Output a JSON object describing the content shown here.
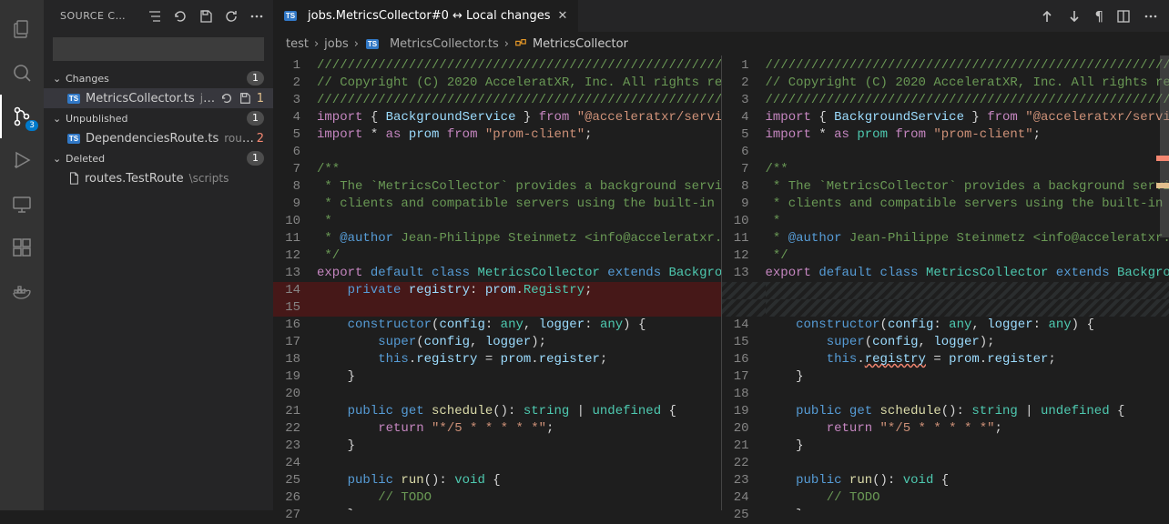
{
  "activity": {
    "scm_badge": "3"
  },
  "sidebar": {
    "title": "SOURCE C…",
    "sections": {
      "changes": {
        "label": "Changes",
        "count": "1"
      },
      "unpublished": {
        "label": "Unpublished",
        "count": "1"
      },
      "deleted": {
        "label": "Deleted",
        "count": "1"
      }
    },
    "files": {
      "changes0": {
        "name": "MetricsCollector.ts",
        "dir": "jobs",
        "status": "1"
      },
      "unpub0": {
        "name": "DependenciesRoute.ts",
        "dir": "routes",
        "status": "2"
      },
      "deleted0": {
        "name": "routes.TestRoute",
        "dir": "\\scripts"
      }
    }
  },
  "tab": {
    "icon": "TS",
    "title": "jobs.MetricsCollector#0 ↔ Local changes"
  },
  "breadcrumb": {
    "a": "test",
    "b": "jobs",
    "c": "MetricsCollector.ts",
    "d": "MetricsCollector"
  },
  "left": {
    "lines": [
      "1",
      "2",
      "3",
      "4",
      "5",
      "6",
      "7",
      "8",
      "9",
      "10",
      "11",
      "12",
      "13",
      "14",
      "15",
      "16",
      "17",
      "18",
      "19",
      "20",
      "21",
      "22",
      "23",
      "24",
      "25",
      "26",
      "27"
    ]
  },
  "right": {
    "lines": [
      "1",
      "2",
      "3",
      "4",
      "5",
      "6",
      "7",
      "8",
      "9",
      "10",
      "11",
      "12",
      "13",
      "",
      "",
      "14",
      "15",
      "16",
      "17",
      "18",
      "19",
      "20",
      "21",
      "22",
      "23",
      "24",
      "25"
    ]
  },
  "code": {
    "l1": "///////////////////////////////////////////////////////////",
    "l2": "// Copyright (C) 2020 AcceleratXR, Inc. All rights res",
    "l3": "///////////////////////////////////////////////////////////",
    "l4a": "import",
    "l4b": " { ",
    "l4c": "BackgroundService",
    "l4d": " } ",
    "l4e": "from",
    "l4f": " \"@acceleratxr/servic",
    "l5a": "import",
    "l5b": " * ",
    "l5c": "as",
    "l5d": " prom ",
    "l5e": "from",
    "l5f": " \"prom-client\"",
    "l5g": ";",
    "l7": "/**",
    "l8": " * The `MetricsCollector` provides a background servic",
    "l9": " * clients and compatible servers using the built-in `",
    "l10": " *",
    "l11a": " * ",
    "l11b": "@author",
    "l11c": " Jean-Philippe Steinmetz <info@acceleratxr.c",
    "l12": " */",
    "l13a": "export",
    "l13b": " default ",
    "l13c": "class",
    "l13d": " MetricsCollector ",
    "l13e": "extends",
    "l13f": " Backgrou",
    "l14a": "    private",
    "l14b": " registry",
    "l14c": ": ",
    "l14d": "prom",
    "l14e": ".",
    "l14f": "Registry",
    "l14g": ";",
    "l16a": "    constructor",
    "l16b": "(",
    "l16c": "config",
    "l16d": ": ",
    "l16e": "any",
    "l16f": ", ",
    "l16g": "logger",
    "l16h": ": ",
    "l16i": "any",
    "l16j": ") {",
    "l17a": "        super",
    "l17b": "(",
    "l17c": "config",
    "l17d": ", ",
    "l17e": "logger",
    "l17f": ");",
    "l18a": "        this",
    "l18b": ".",
    "l18c": "registry",
    "l18d": " = ",
    "l18e": "prom",
    "l18f": ".",
    "l18g": "register",
    "l18h": ";",
    "l19": "    }",
    "l21a": "    public",
    "l21b": " get ",
    "l21c": "schedule",
    "l21d": "(): ",
    "l21e": "string",
    "l21f": " | ",
    "l21g": "undefined",
    "l21h": " {",
    "l22a": "        return",
    "l22b": " \"*/5 * * * * *\"",
    "l22c": ";",
    "l23": "    }",
    "l25a": "    public",
    "l25b": " run",
    "l25c": "(): ",
    "l25d": "void",
    "l25e": " {",
    "l26": "        // TODO",
    "l27": "    }",
    "r5d": " ",
    "r5d2": "prom",
    "r5d3": " "
  }
}
